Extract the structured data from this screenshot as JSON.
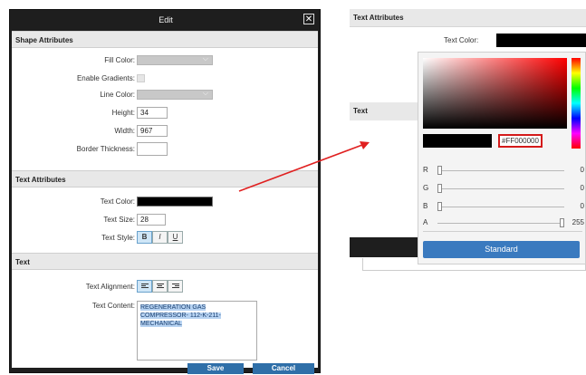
{
  "dialog": {
    "title": "Edit",
    "close_symbol": "✕",
    "shape_section": {
      "title": "Shape Attributes",
      "fill_color_label": "Fill Color:",
      "enable_gradients_label": "Enable Gradients:",
      "line_color_label": "Line Color:",
      "height_label": "Height:",
      "height_value": "34",
      "width_label": "Width:",
      "width_value": "967",
      "border_thickness_label": "Border Thickness:",
      "border_thickness_value": "",
      "dropdown_color": "#c8c8c8"
    },
    "text_attr_section": {
      "title": "Text Attributes",
      "text_color_label": "Text Color:",
      "text_color": "#000000",
      "text_size_label": "Text Size:",
      "text_size_value": "28",
      "text_style_label": "Text Style:",
      "style_buttons": [
        "B",
        "I",
        "U"
      ]
    },
    "text_section": {
      "title": "Text",
      "alignment_label": "Text Alignment:",
      "alignment_icons": [
        "align-left-icon",
        "align-center-icon",
        "align-right-icon"
      ],
      "content_label": "Text Content:",
      "content_lines": [
        "REGENERATION GAS",
        "COMPRESSOR- 112-K-211-",
        "MECHANICAL"
      ]
    },
    "footer": {
      "save_label": "Save",
      "cancel_label": "Cancel",
      "button_color": "#2f6fa8"
    }
  },
  "right_panel": {
    "header": "Text Attributes",
    "text_color_label": "Text Color:",
    "text_header": "Text",
    "picker": {
      "hex_value": "#FF000000",
      "hex_border_color": "#d41a1a",
      "channels": [
        {
          "label": "R",
          "value": "0",
          "level": 0
        },
        {
          "label": "G",
          "value": "0",
          "level": 0
        },
        {
          "label": "B",
          "value": "0",
          "level": 0
        },
        {
          "label": "A",
          "value": "255",
          "level": 1
        }
      ],
      "standard_label": "Standard",
      "standard_color": "#3a7abf"
    }
  },
  "annotation": {
    "arrow_color": "#e02020"
  }
}
